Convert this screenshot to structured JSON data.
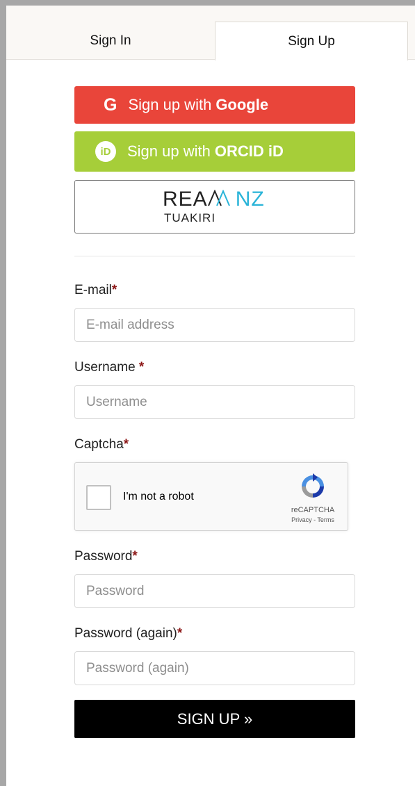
{
  "tabs": [
    {
      "label": "Sign In",
      "active": false
    },
    {
      "label": "Sign Up",
      "active": true
    }
  ],
  "social": {
    "google": {
      "prefix": "Sign up with",
      "provider": "Google",
      "icon": "G",
      "color": "#e9453a"
    },
    "orcid": {
      "prefix": "Sign up with",
      "provider": "ORCID iD",
      "icon": "iD",
      "color": "#a6ce39"
    },
    "tuakiri": {
      "brand_main": "REA",
      "brand_accent": "NZ",
      "subtitle": "TUAKIRI",
      "accent_color": "#2ab4d8"
    }
  },
  "fields": {
    "email": {
      "label": "E-mail",
      "required_mark": "*",
      "placeholder": "E-mail address"
    },
    "username": {
      "label": "Username ",
      "required_mark": "*",
      "placeholder": "Username"
    },
    "captcha": {
      "label": "Captcha",
      "required_mark": "*"
    },
    "password": {
      "label": "Password",
      "required_mark": "*",
      "placeholder": "Password"
    },
    "password2": {
      "label": "Password (again)",
      "required_mark": "*",
      "placeholder": "Password (again)"
    }
  },
  "recaptcha": {
    "checkbox_label": "I'm not a robot",
    "brand": "reCAPTCHA",
    "links": "Privacy - Terms"
  },
  "submit": {
    "label": "SIGN UP »"
  },
  "colors": {
    "required": "#8b1414",
    "submit_bg": "#000000"
  }
}
